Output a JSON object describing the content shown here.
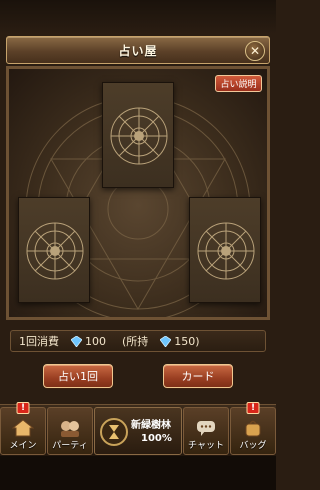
{
  "header": {
    "title": "占い屋",
    "close_symbol": "✕"
  },
  "board": {
    "help_label": "占い説明",
    "cards": [
      {
        "label": "card-top"
      },
      {
        "label": "card-left"
      },
      {
        "label": "card-right"
      }
    ]
  },
  "cost": {
    "per_label": "1回消費",
    "per_value": "100",
    "owned_prefix": "(所持",
    "owned_value": "150)"
  },
  "buttons": {
    "fortune_once": "占い1回",
    "card": "カード"
  },
  "nav": {
    "items": [
      {
        "label": "メイン",
        "badge": "!"
      },
      {
        "label": "パーティ"
      },
      {
        "label": "チャット"
      },
      {
        "label": "バッグ",
        "badge": "!"
      }
    ],
    "location": {
      "name": "新緑樹林",
      "progress": "100%"
    }
  },
  "colors": {
    "accent": "#9a3f22",
    "frame": "#6e5234",
    "badge": "#d8261a"
  }
}
